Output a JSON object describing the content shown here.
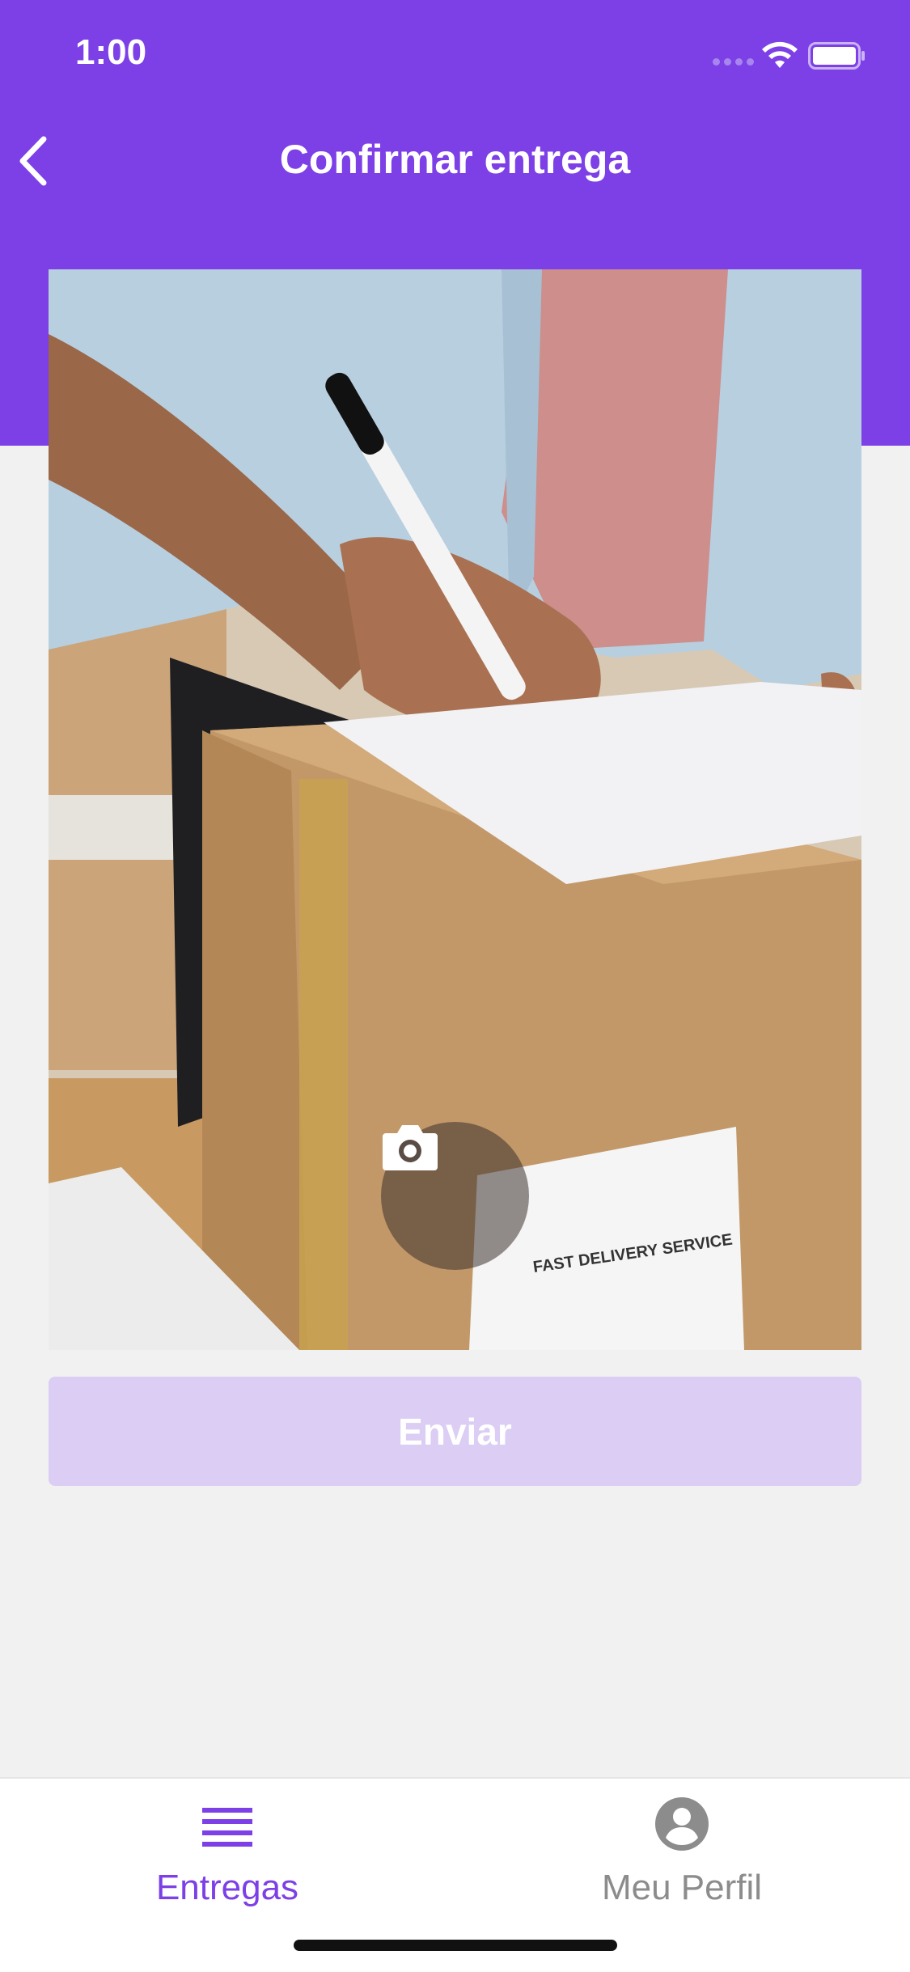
{
  "status_bar": {
    "time": "1:00"
  },
  "header": {
    "title": "Confirmar entrega",
    "back_icon": "chevron-left-icon"
  },
  "photo": {
    "camera_icon": "camera-icon"
  },
  "submit": {
    "label": "Enviar"
  },
  "tab_bar": {
    "tabs": [
      {
        "label": "Entregas",
        "icon": "list-icon",
        "active": true
      },
      {
        "label": "Meu Perfil",
        "icon": "account-circle-icon",
        "active": false
      }
    ]
  },
  "colors": {
    "primary": "#7d40e7",
    "submit_disabled": "#dbcdf3",
    "background": "#f1f1f1",
    "inactive_tab": "#8c8c8c"
  }
}
